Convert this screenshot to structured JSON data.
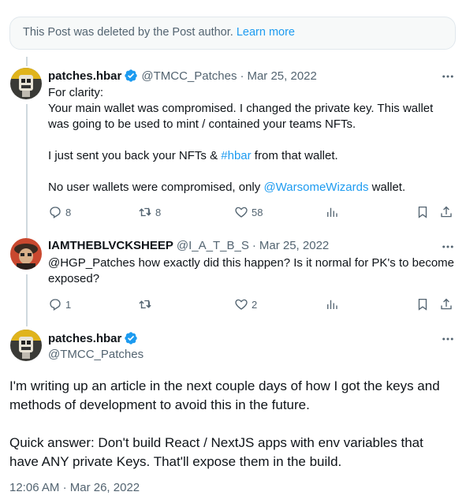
{
  "deleted_notice": {
    "text": "This Post was deleted by the Post author.",
    "link": "Learn more"
  },
  "tweets": [
    {
      "name": "patches.hbar",
      "handle": "@TMCC_Patches",
      "separator": "·",
      "date": "Mar 25, 2022",
      "lines": {
        "l1": "For clarity:",
        "l2": "Your main wallet was compromised. I changed the private key. This wallet",
        "l3": "was going to be used to mint / contained your teams NFTs.",
        "l4a": "I just sent you back your NFTs & ",
        "l4link": "#hbar",
        "l4b": " from that wallet.",
        "l5a": "No user wallets were compromised, only ",
        "l5link": "@WarsomeWizards",
        "l5b": " wallet."
      },
      "replies": "8",
      "reposts": "8",
      "likes": "58"
    },
    {
      "name": "IAMTHEBLVCKSHEEP",
      "handle": "@I_A_T_B_S",
      "separator": "·",
      "date": "Mar 25, 2022",
      "lines": {
        "l1": "@HGP_Patches how exactly did this happen? Is it normal for PK's to become",
        "l2": "exposed?"
      },
      "replies": "1",
      "likes": "2"
    }
  ],
  "main_tweet": {
    "name": "patches.hbar",
    "handle": "@TMCC_Patches",
    "lines": {
      "l1": "I'm writing up an article in the next couple days of how I got the keys and",
      "l2": "methods of development to avoid this in the future.",
      "l3": "Quick answer: Don't build React / NextJS apps with env variables that",
      "l4": "have ANY private Keys. That'll expose them in the build."
    },
    "time": "12:06 AM",
    "separator": "·",
    "date": "Mar 26, 2022"
  },
  "colors": {
    "accent": "#1d9bf0",
    "muted": "#536471",
    "text": "#0f1419"
  },
  "icons": [
    "verified-badge-icon",
    "more-icon",
    "reply-icon",
    "repost-icon",
    "like-icon",
    "views-icon",
    "bookmark-icon",
    "share-icon"
  ]
}
